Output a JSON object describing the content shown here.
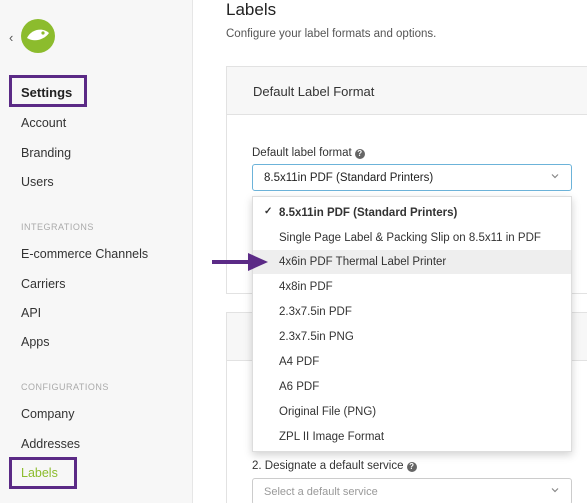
{
  "sidebar": {
    "active_heading": "Settings",
    "items_top": [
      "Account",
      "Branding",
      "Users"
    ],
    "section_integrations": "INTEGRATIONS",
    "items_integrations": [
      "E-commerce Channels",
      "Carriers",
      "API",
      "Apps"
    ],
    "section_configurations": "CONFIGURATIONS",
    "items_configurations": [
      "Company",
      "Addresses",
      "Labels"
    ]
  },
  "header": {
    "title": "Labels",
    "subtitle": "Configure your label formats and options."
  },
  "card1": {
    "title": "Default Label Format",
    "field_label": "Default label format",
    "selected_value": "8.5x11in PDF (Standard Printers)"
  },
  "dropdown": {
    "options": [
      "8.5x11in PDF (Standard Printers)",
      "Single Page Label & Packing Slip on 8.5x11 in PDF",
      "4x6in PDF Thermal Label Printer",
      "4x8in PDF",
      "2.3x7.5in PDF",
      "2.3x7.5in PNG",
      "A4 PDF",
      "A6 PDF",
      "Original File (PNG)",
      "ZPL II Image Format"
    ]
  },
  "card2": {
    "field_label": "2. Designate a default service",
    "placeholder": "Select a default service"
  },
  "colors": {
    "annotation": "#5b2a86",
    "brand_green": "#8cbc2d",
    "focus_border": "#6cb3d9"
  },
  "icons": {
    "logo": "bird-logo-icon",
    "help": "help-circle-icon",
    "chevron": "chevron-down-icon",
    "check": "check-icon",
    "arrow": "arrow-right-icon"
  }
}
